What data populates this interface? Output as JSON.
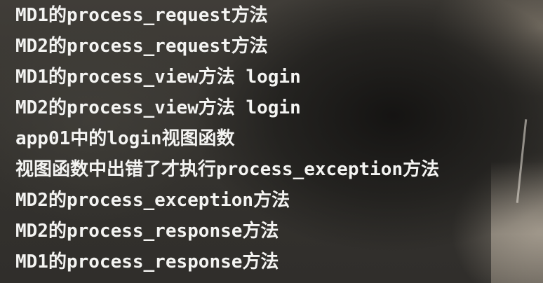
{
  "terminal": {
    "lines": [
      "MD1的process_request方法",
      "MD2的process_request方法",
      "MD1的process_view方法 login",
      "MD2的process_view方法 login",
      "app01中的login视图函数",
      "视图函数中出错了才执行process_exception方法",
      "MD2的process_exception方法",
      "MD2的process_response方法",
      "MD1的process_response方法"
    ]
  }
}
